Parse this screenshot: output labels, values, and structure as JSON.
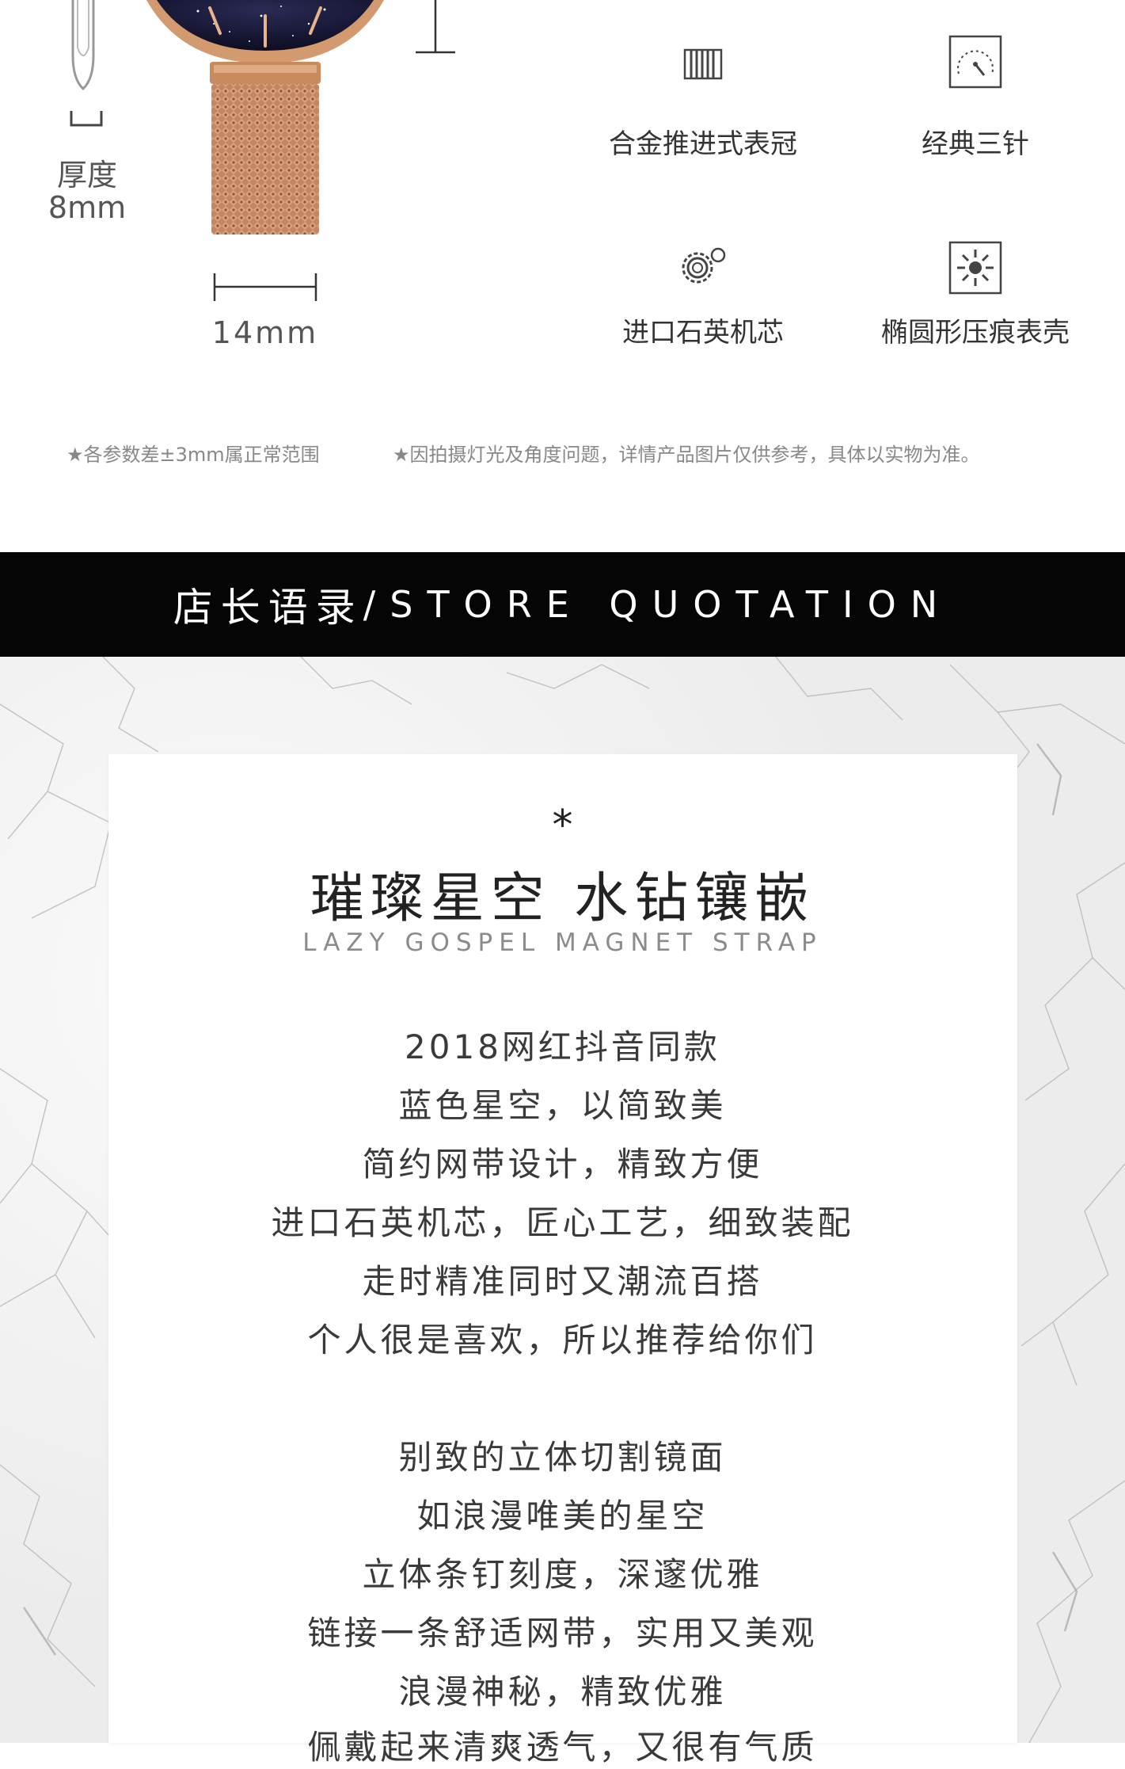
{
  "spec": {
    "thickness_label": "厚度",
    "thickness_value": "8mm",
    "width_value": "14mm",
    "features": [
      {
        "label": "合金推进式表冠",
        "icon": "crown-icon"
      },
      {
        "label": "经典三针",
        "icon": "dial-icon"
      },
      {
        "label": "进口石英机芯",
        "icon": "gear-icon"
      },
      {
        "label": "椭圆形压痕表壳",
        "icon": "sun-icon"
      }
    ],
    "notes": [
      "★各参数差±3mm属正常范围",
      "★因拍摄灯光及角度问题，详情产品图片仅供参考，具体以实物为准。"
    ]
  },
  "banner": {
    "cn": "店长语录",
    "en": "/STORE QUOTATION"
  },
  "quote": {
    "star": "*",
    "title_cn": "璀璨星空 水钻镶嵌",
    "title_en": "LAZY GOSPEL MAGNET STRAP",
    "lines": [
      "2018网红抖音同款",
      "蓝色星空，以简致美",
      "简约网带设计，精致方便",
      "进口石英机芯，匠心工艺，细致装配",
      "走时精准同时又潮流百搭",
      "个人很是喜欢，所以推荐给你们",
      "别致的立体切割镜面",
      "如浪漫唯美的星空",
      "立体条钉刻度，深邃优雅",
      "链接一条舒适网带，实用又美观",
      "浪漫神秘，精致优雅",
      "佩戴起来清爽透气，又很有气质"
    ]
  },
  "colors": {
    "banner_bg": "#050505",
    "rose_gold": "#c98a5e",
    "dial": "#1a1a3a"
  }
}
